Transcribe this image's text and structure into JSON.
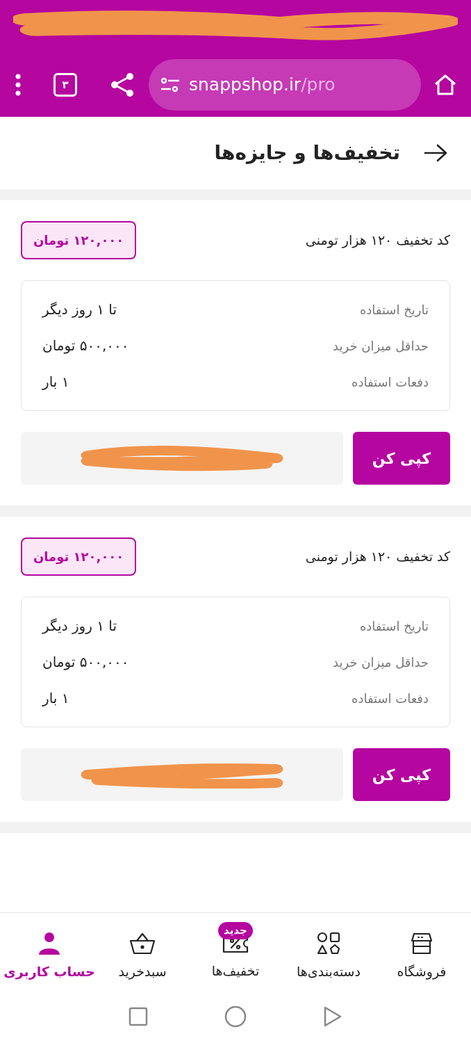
{
  "browser": {
    "url_host": "snappshop.ir",
    "url_path": "/pro",
    "tab_count": "۳"
  },
  "header": {
    "title": "تخفیف‌ها و جایزه‌ها"
  },
  "coupons": [
    {
      "title": "کد تخفیف ۱۲۰ هزار تومنی",
      "amount": "۱۲۰,۰۰۰ تومان",
      "details": [
        {
          "label": "تاریخ استفاده",
          "value": "تا ۱ روز دیگر"
        },
        {
          "label": "حداقل میزان خرید",
          "value": "۵۰۰,۰۰۰ تومان"
        },
        {
          "label": "دفعات استفاده",
          "value": "۱ بار"
        }
      ],
      "copy_button": "کپی کن"
    },
    {
      "title": "کد تخفیف ۱۲۰ هزار تومنی",
      "amount": "۱۲۰,۰۰۰ تومان",
      "details": [
        {
          "label": "تاریخ استفاده",
          "value": "تا ۱ روز دیگر"
        },
        {
          "label": "حداقل میزان خرید",
          "value": "۵۰۰,۰۰۰ تومان"
        },
        {
          "label": "دفعات استفاده",
          "value": "۱ بار"
        }
      ],
      "copy_button": "کپی کن"
    }
  ],
  "bottom_nav": [
    {
      "kind": "store",
      "label": "فروشگاه",
      "selected": false
    },
    {
      "kind": "categories",
      "label": "دسته‌بندی‌ها",
      "selected": false
    },
    {
      "kind": "discounts",
      "label": "تخفیف‌ها",
      "selected": false,
      "badge": "جدید"
    },
    {
      "kind": "cart",
      "label": "سبدخرید",
      "selected": false
    },
    {
      "kind": "account",
      "label": "حساب کاربری",
      "selected": true
    }
  ]
}
